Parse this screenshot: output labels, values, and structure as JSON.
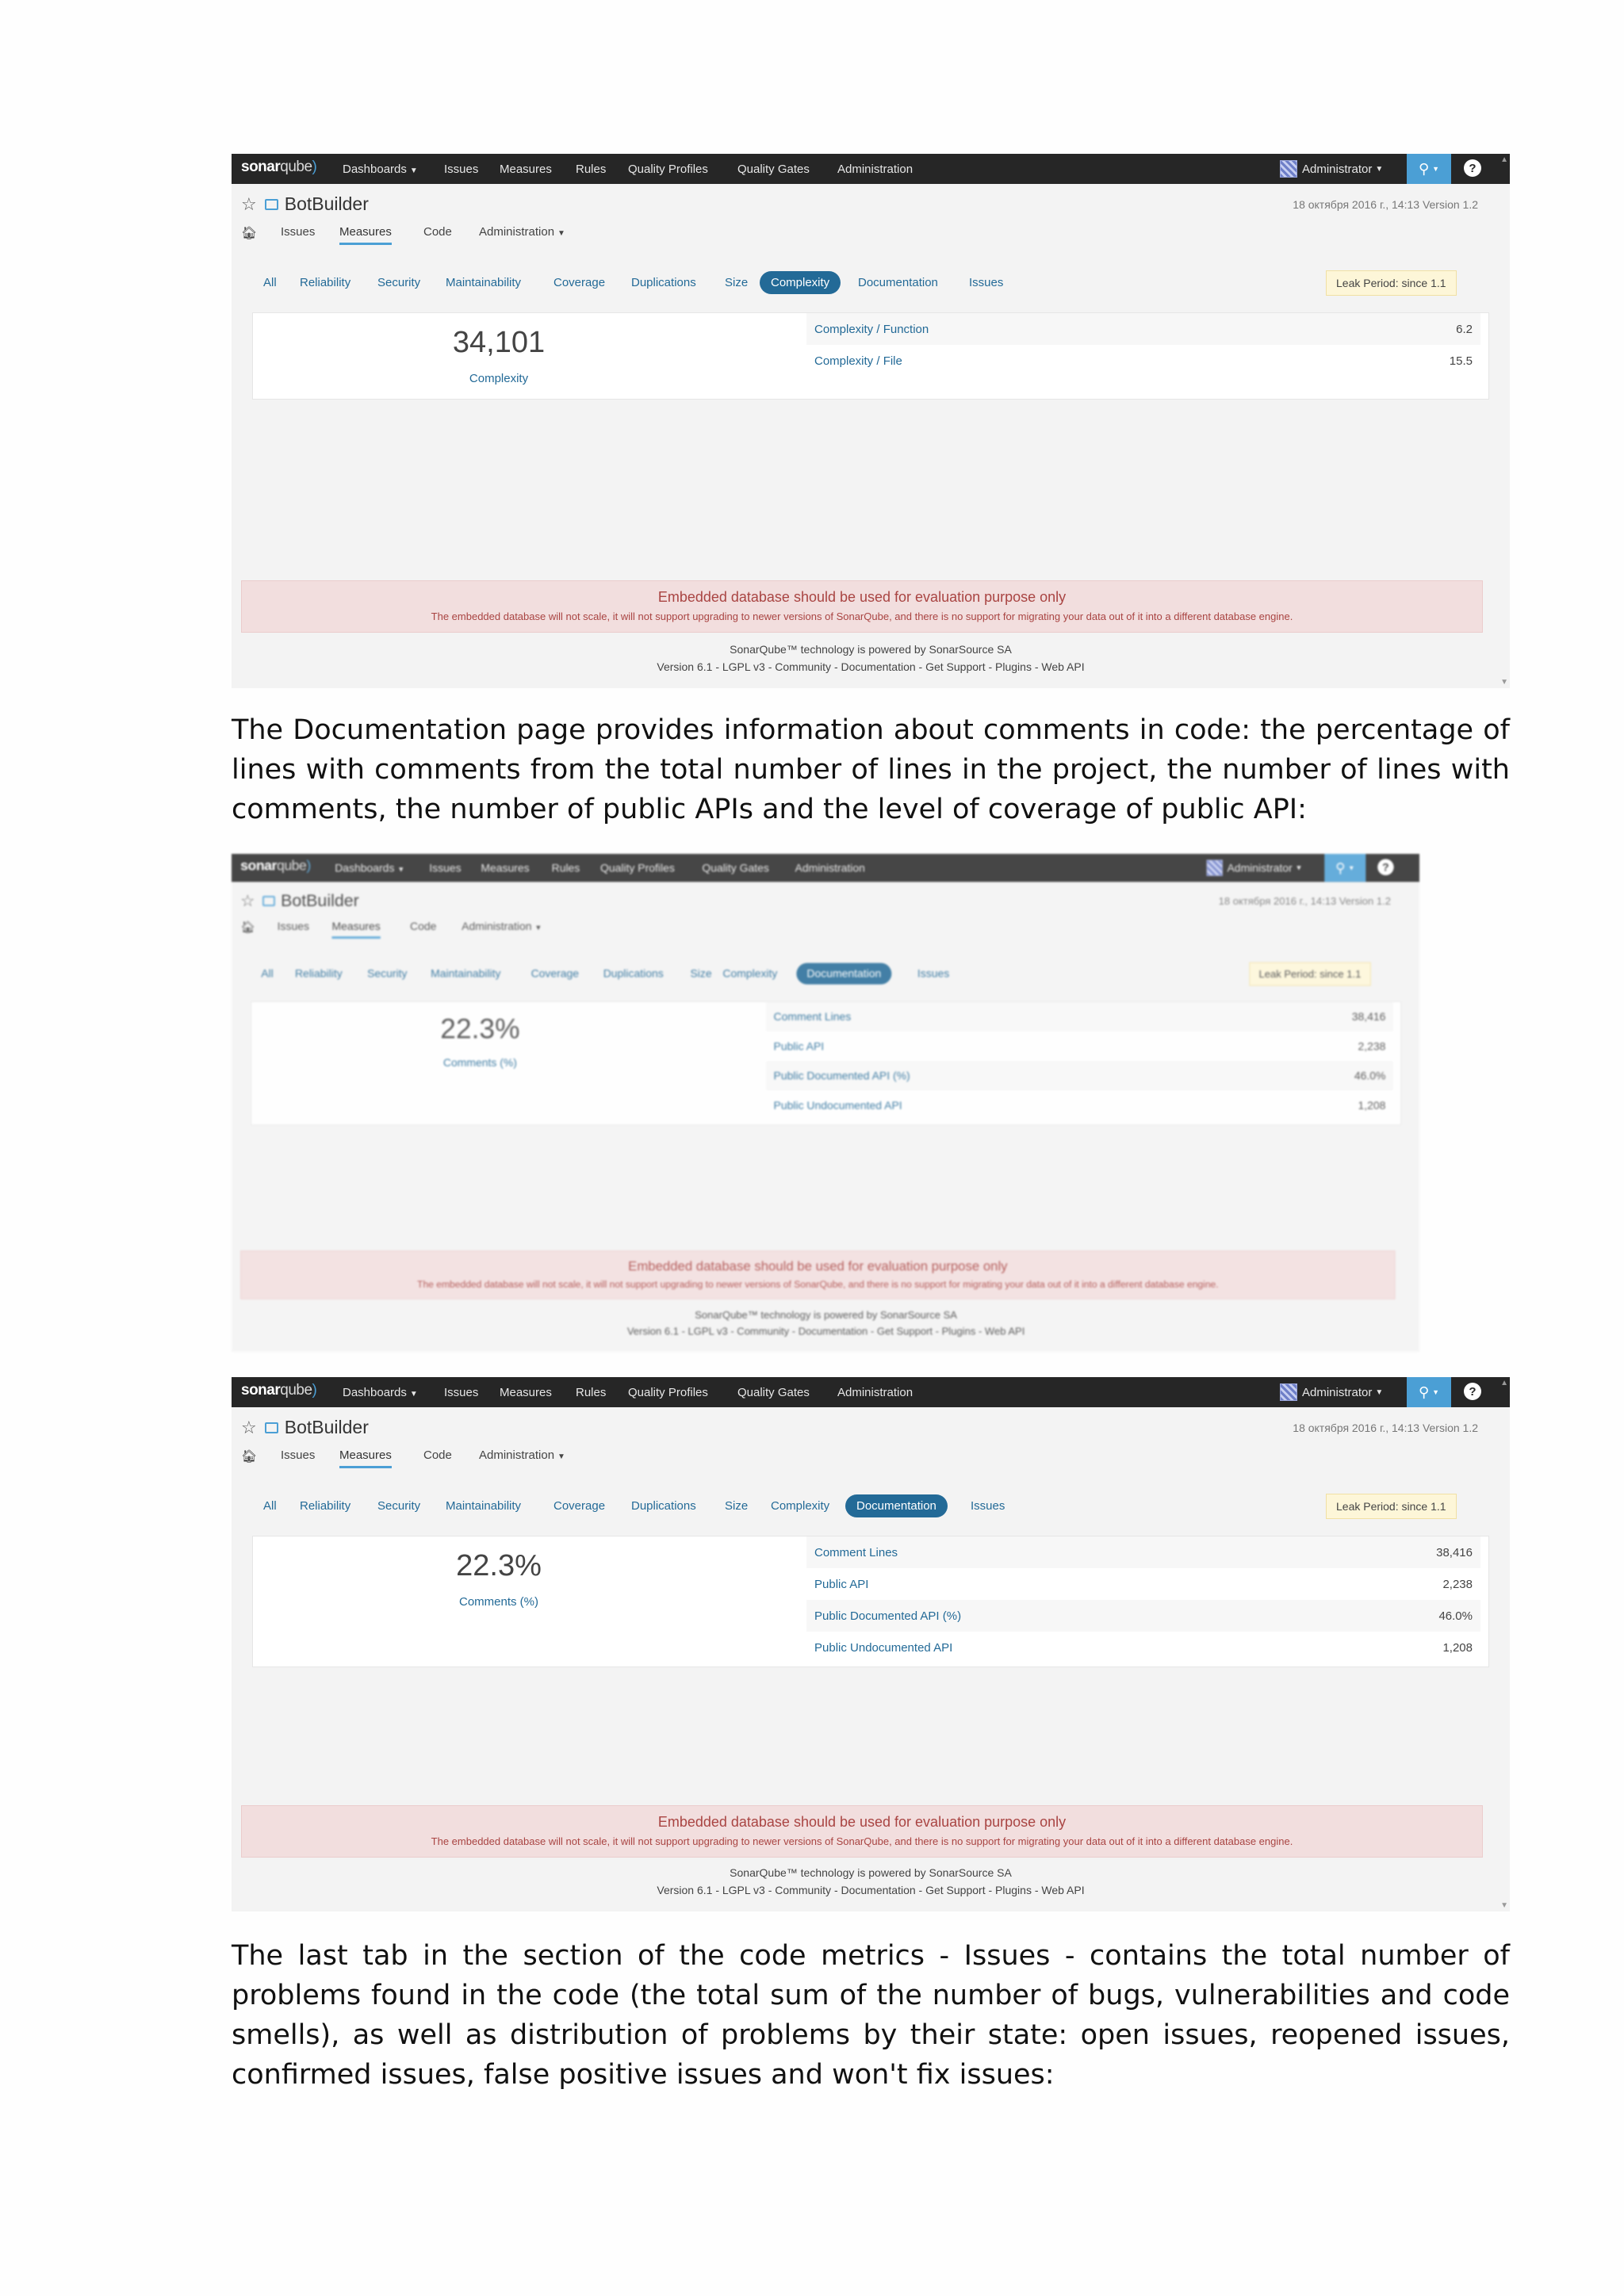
{
  "shot1": {
    "brand": {
      "bold": "sonar",
      "light": "qube"
    },
    "navbar": [
      "Dashboards",
      "Issues",
      "Measures",
      "Rules",
      "Quality Profiles",
      "Quality Gates",
      "Administration"
    ],
    "admin": "Administrator",
    "project": "BotBuilder",
    "meta": "18 октября 2016 г., 14:13   Version 1.2",
    "project_nav": [
      "Issues",
      "Measures",
      "Code",
      "Administration"
    ],
    "tabs": [
      "All",
      "Reliability",
      "Security",
      "Maintainability",
      "Coverage",
      "Duplications",
      "Size",
      "Complexity",
      "Documentation",
      "Issues"
    ],
    "leak": "Leak Period: since 1.1",
    "big_value": "34,101",
    "big_label": "Complexity",
    "metrics": [
      {
        "name": "Complexity / Function",
        "value": "6.2"
      },
      {
        "name": "Complexity / File",
        "value": "15.5"
      }
    ],
    "warning_title": "Embedded database should be used for evaluation purpose only",
    "warning_text": "The embedded database will not scale, it will not support upgrading to newer versions of SonarQube, and there is no support for migrating your data out of it into a different database engine.",
    "footer1": "SonarQube™ technology is powered by SonarSource SA",
    "footer2": "Version 6.1 - LGPL v3 - Community - Documentation - Get Support - Plugins - Web API"
  },
  "paragraph1": "The Documentation page provides information about comments in code: the percentage of lines with comments from the total number of lines in the project, the number of lines with comments, the number of public APIs and the level of coverage of public API:",
  "shot2": {
    "brand": {
      "bold": "sonar",
      "light": "qube"
    },
    "navbar": [
      "Dashboards",
      "Issues",
      "Measures",
      "Rules",
      "Quality Profiles",
      "Quality Gates",
      "Administration"
    ],
    "admin": "Administrator",
    "project": "BotBuilder",
    "meta": "18 октября 2016 г., 14:13   Version 1.2",
    "project_nav": [
      "Issues",
      "Measures",
      "Code",
      "Administration"
    ],
    "tabs": [
      "All",
      "Reliability",
      "Security",
      "Maintainability",
      "Coverage",
      "Duplications",
      "Size",
      "Complexity",
      "Documentation",
      "Issues"
    ],
    "leak": "Leak Period: since 1.1",
    "big_value": "22.3%",
    "big_label": "Comments (%)",
    "metrics": [
      {
        "name": "Comment Lines",
        "value": "38,416"
      },
      {
        "name": "Public API",
        "value": "2,238"
      },
      {
        "name": "Public Documented API (%)",
        "value": "46.0%"
      },
      {
        "name": "Public Undocumented API",
        "value": "1,208"
      }
    ],
    "warning_title": "Embedded database should be used for evaluation purpose only",
    "warning_text": "The embedded database will not scale, it will not support upgrading to newer versions of SonarQube, and there is no support for migrating your data out of it into a different database engine.",
    "footer1": "SonarQube™ technology is powered by SonarSource SA",
    "footer2": "Version 6.1 - LGPL v3 - Community - Documentation - Get Support - Plugins - Web API"
  },
  "shot3": {
    "brand": {
      "bold": "sonar",
      "light": "qube"
    },
    "navbar": [
      "Dashboards",
      "Issues",
      "Measures",
      "Rules",
      "Quality Profiles",
      "Quality Gates",
      "Administration"
    ],
    "admin": "Administrator",
    "project": "BotBuilder",
    "meta": "18 октября 2016 г., 14:13   Version 1.2",
    "project_nav": [
      "Issues",
      "Measures",
      "Code",
      "Administration"
    ],
    "tabs": [
      "All",
      "Reliability",
      "Security",
      "Maintainability",
      "Coverage",
      "Duplications",
      "Size",
      "Complexity",
      "Documentation",
      "Issues"
    ],
    "leak": "Leak Period: since 1.1",
    "big_value": "22.3%",
    "big_label": "Comments (%)",
    "metrics": [
      {
        "name": "Comment Lines",
        "value": "38,416"
      },
      {
        "name": "Public API",
        "value": "2,238"
      },
      {
        "name": "Public Documented API (%)",
        "value": "46.0%"
      },
      {
        "name": "Public Undocumented API",
        "value": "1,208"
      }
    ],
    "warning_title": "Embedded database should be used for evaluation purpose only",
    "warning_text": "The embedded database will not scale, it will not support upgrading to newer versions of SonarQube, and there is no support for migrating your data out of it into a different database engine.",
    "footer1": "SonarQube™ technology is powered by SonarSource SA",
    "footer2": "Version 6.1 - LGPL v3 - Community - Documentation - Get Support - Plugins - Web API"
  },
  "paragraph2": "The last tab in the section of the code metrics - Issues - contains the total number of problems found in the code (the total sum of the number of bugs, vulnerabilities and code smells), as well as distribution of problems by their state: open issues, reopened issues, confirmed issues, false positive issues and won't fix issues:"
}
